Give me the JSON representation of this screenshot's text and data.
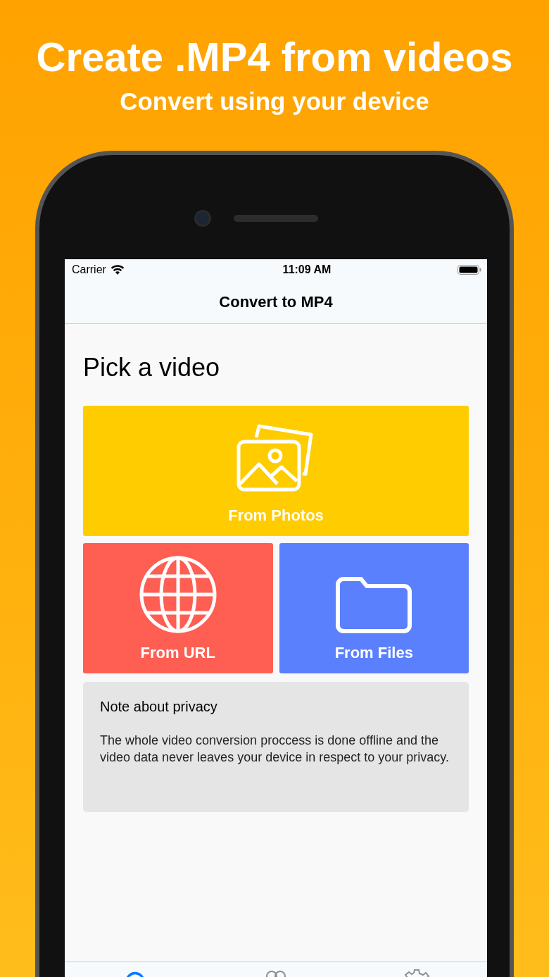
{
  "headline": "Create .MP4 from videos",
  "subheadline": "Convert using your device",
  "status_bar": {
    "carrier": "Carrier",
    "time": "11:09 AM"
  },
  "nav": {
    "title": "Convert to MP4"
  },
  "heading": "Pick a video",
  "sources": [
    {
      "label": "From Photos",
      "color": "#ffcc00"
    },
    {
      "label": "From URL",
      "color": "#ff5e52"
    },
    {
      "label": "From Files",
      "color": "#5b80fe"
    }
  ],
  "note": {
    "title": "Note about privacy",
    "body": "The whole video conversion proccess is done offline and the video data never leaves your device in respect to your privacy."
  },
  "tab_bar": [
    {
      "selected": true
    },
    {
      "selected": false
    },
    {
      "selected": false
    }
  ]
}
